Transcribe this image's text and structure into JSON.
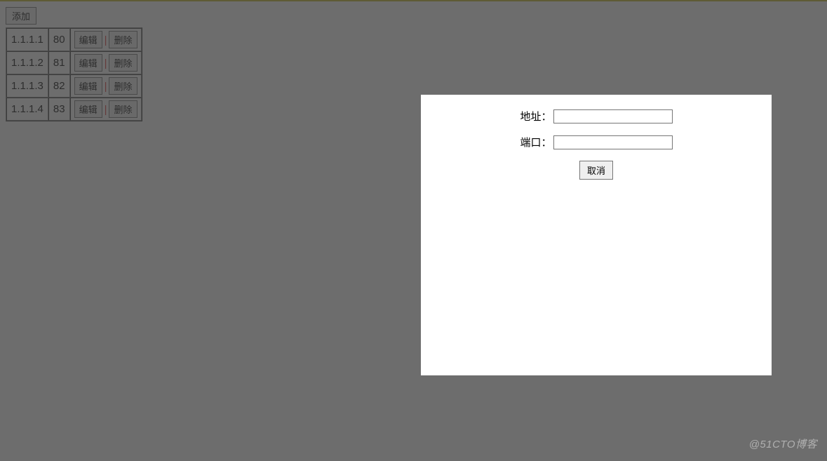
{
  "toolbar": {
    "add_label": "添加"
  },
  "table": {
    "rows": [
      {
        "ip": "1.1.1.1",
        "port": "80"
      },
      {
        "ip": "1.1.1.2",
        "port": "81"
      },
      {
        "ip": "1.1.1.3",
        "port": "82"
      },
      {
        "ip": "1.1.1.4",
        "port": "83"
      }
    ],
    "edit_label": "编辑",
    "delete_label": "删除",
    "separator": "|"
  },
  "modal": {
    "address_label": "地址：",
    "port_label": "端口：",
    "address_value": "",
    "port_value": "",
    "cancel_label": "取消"
  },
  "watermark": "@51CTO博客"
}
